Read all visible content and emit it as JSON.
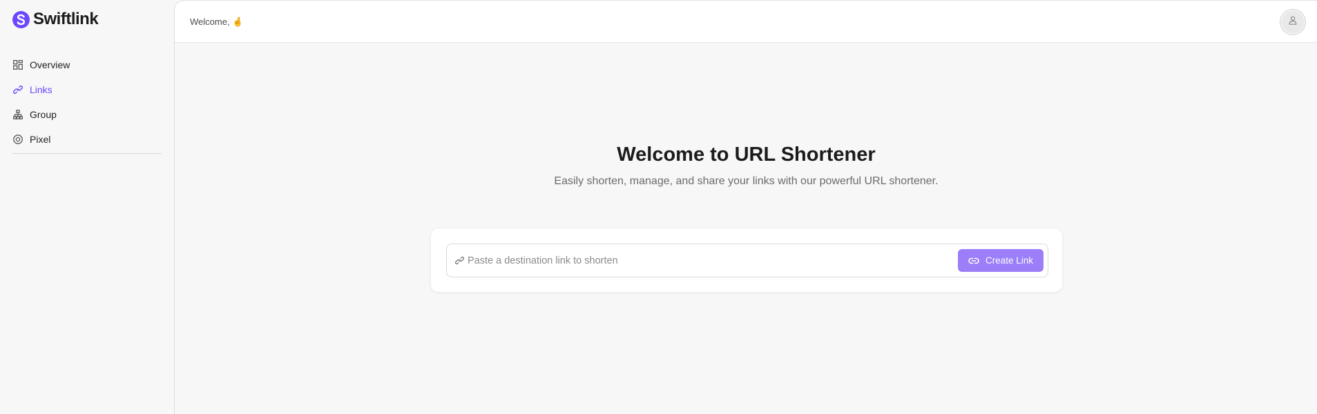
{
  "app": {
    "name": "Swiftlink",
    "brand_color": "#6c47ff"
  },
  "sidebar": {
    "items": [
      {
        "label": "Overview",
        "icon": "grid-icon",
        "active": false
      },
      {
        "label": "Links",
        "icon": "link-icon",
        "active": true
      },
      {
        "label": "Group",
        "icon": "hierarchy-icon",
        "active": false
      },
      {
        "label": "Pixel",
        "icon": "target-icon",
        "active": false
      }
    ]
  },
  "header": {
    "welcome": "Welcome, 🤞",
    "avatar_icon": "user-icon"
  },
  "hero": {
    "title": "Welcome to URL Shortener",
    "subtitle": "Easily shorten, manage, and share your links with our powerful URL shortener."
  },
  "shortener": {
    "placeholder": "Paste a destination link to shorten",
    "value": "",
    "button_label": "Create Link",
    "button_color": "#9b7ef8"
  }
}
